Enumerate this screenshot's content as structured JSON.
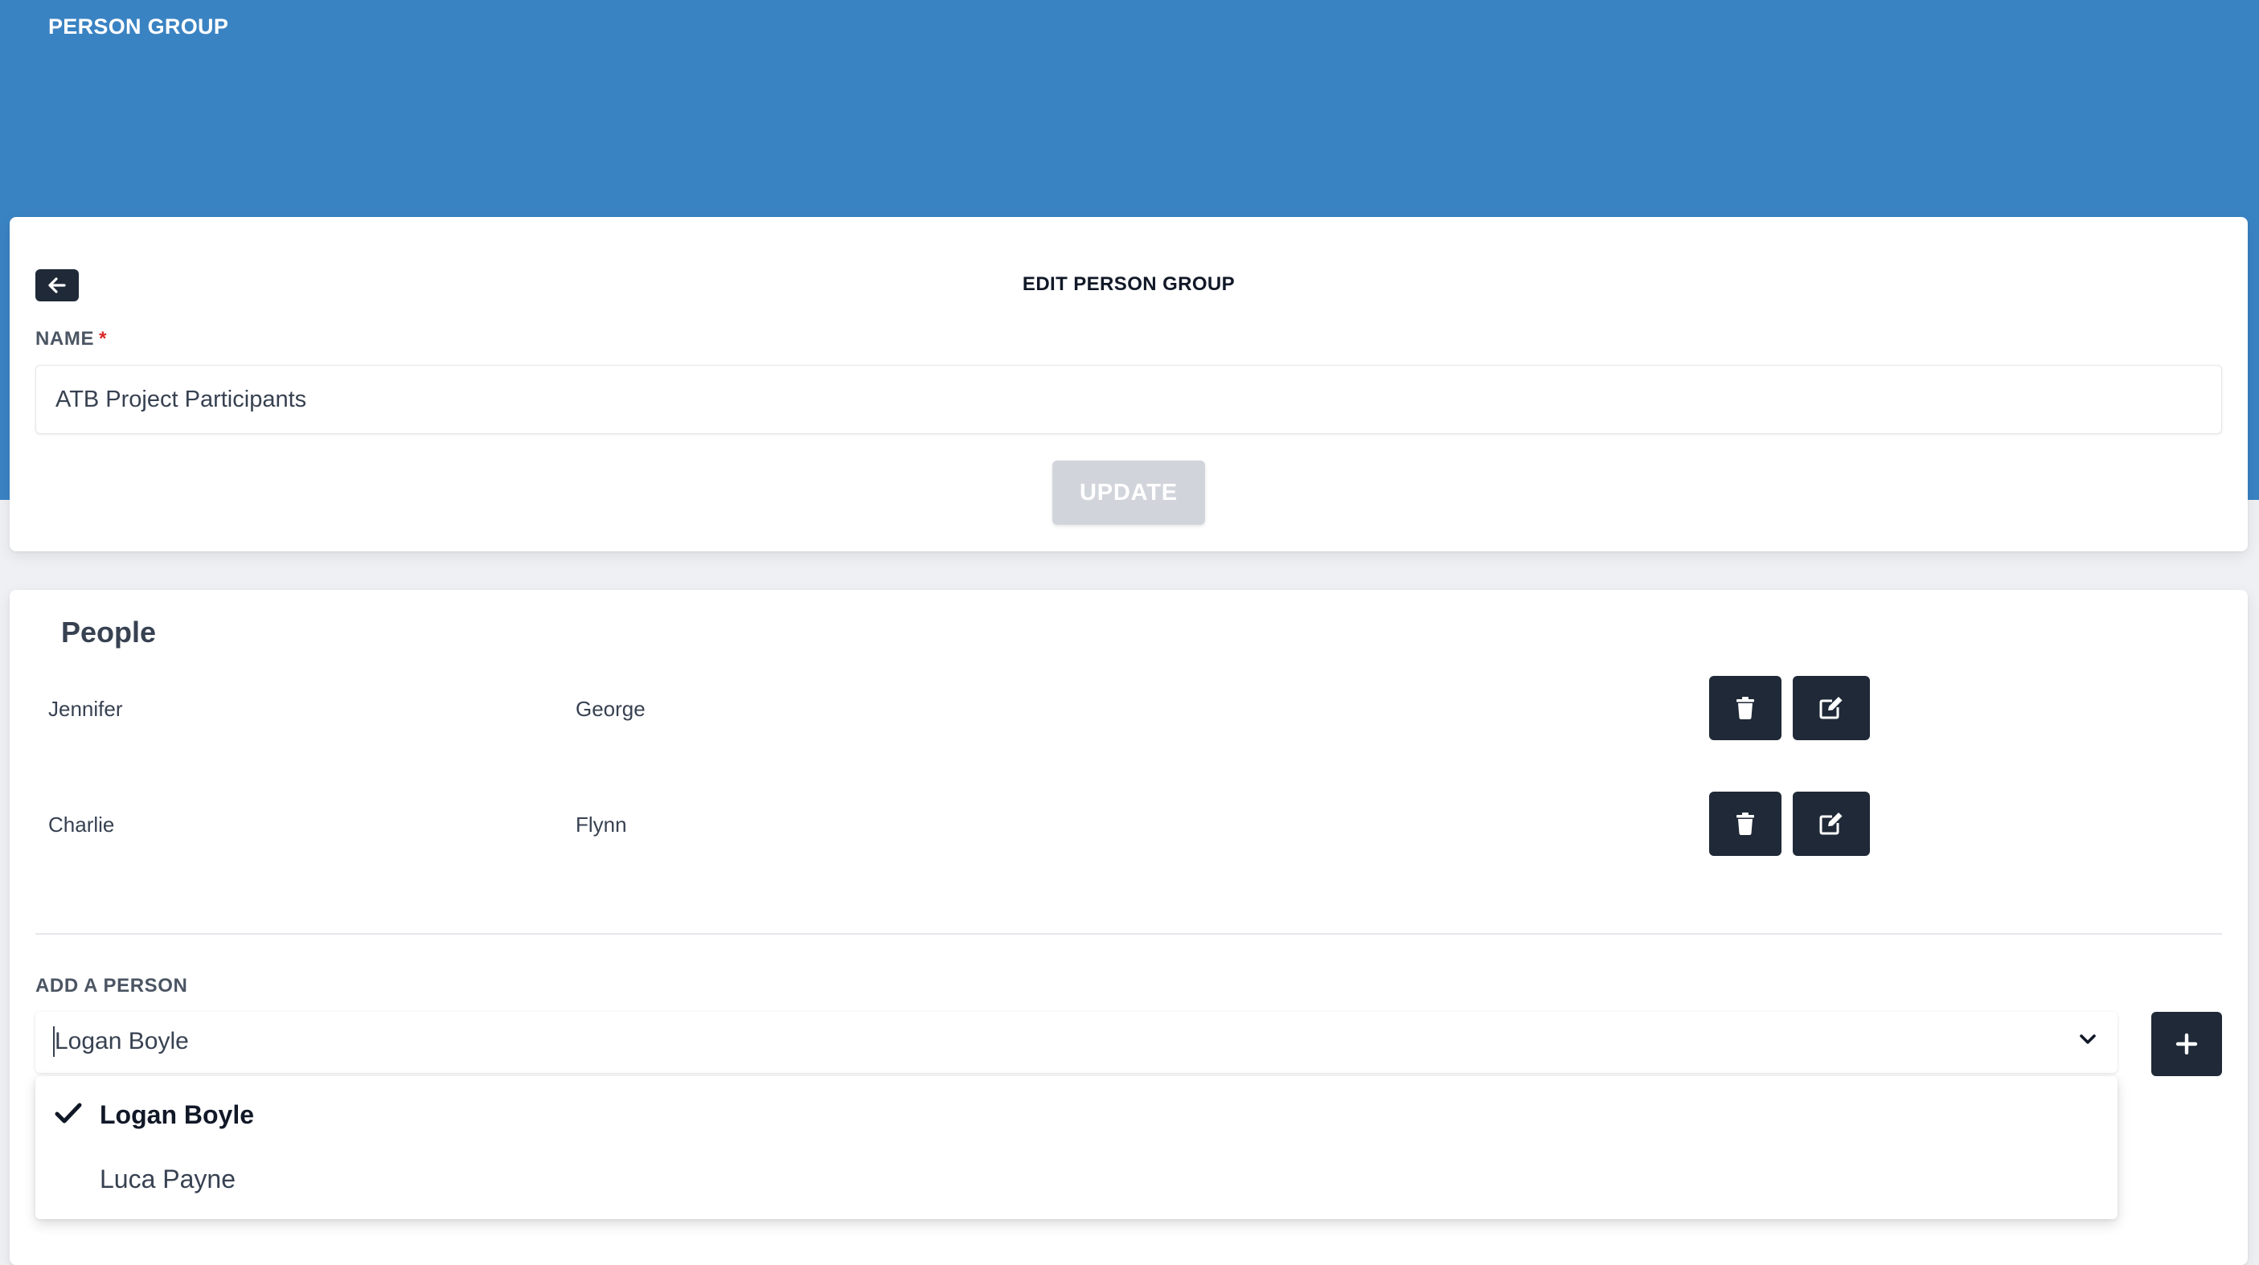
{
  "header": {
    "title": "PERSON GROUP",
    "background": "#3a83c3"
  },
  "edit_card": {
    "back_icon": "arrow-left-icon",
    "title": "EDIT PERSON GROUP",
    "name_label": "NAME",
    "required_mark": "*",
    "name_value": "ATB Project Participants",
    "update_label": "UPDATE"
  },
  "people": {
    "title": "People",
    "rows": [
      {
        "first": "Jennifer",
        "last": "George"
      },
      {
        "first": "Charlie",
        "last": "Flynn"
      }
    ],
    "delete_icon": "trash-icon",
    "edit_icon": "edit-icon"
  },
  "add_person": {
    "label": "ADD A PERSON",
    "selected": "Logan Boyle",
    "chevron_icon": "chevron-down-icon",
    "add_icon": "plus-icon",
    "options": [
      {
        "label": "Logan Boyle",
        "selected": true
      },
      {
        "label": "Luca Payne",
        "selected": false
      }
    ]
  },
  "colors": {
    "dark_button": "#1f2937",
    "disabled_button": "#d1d5db",
    "required": "#dc2626"
  }
}
